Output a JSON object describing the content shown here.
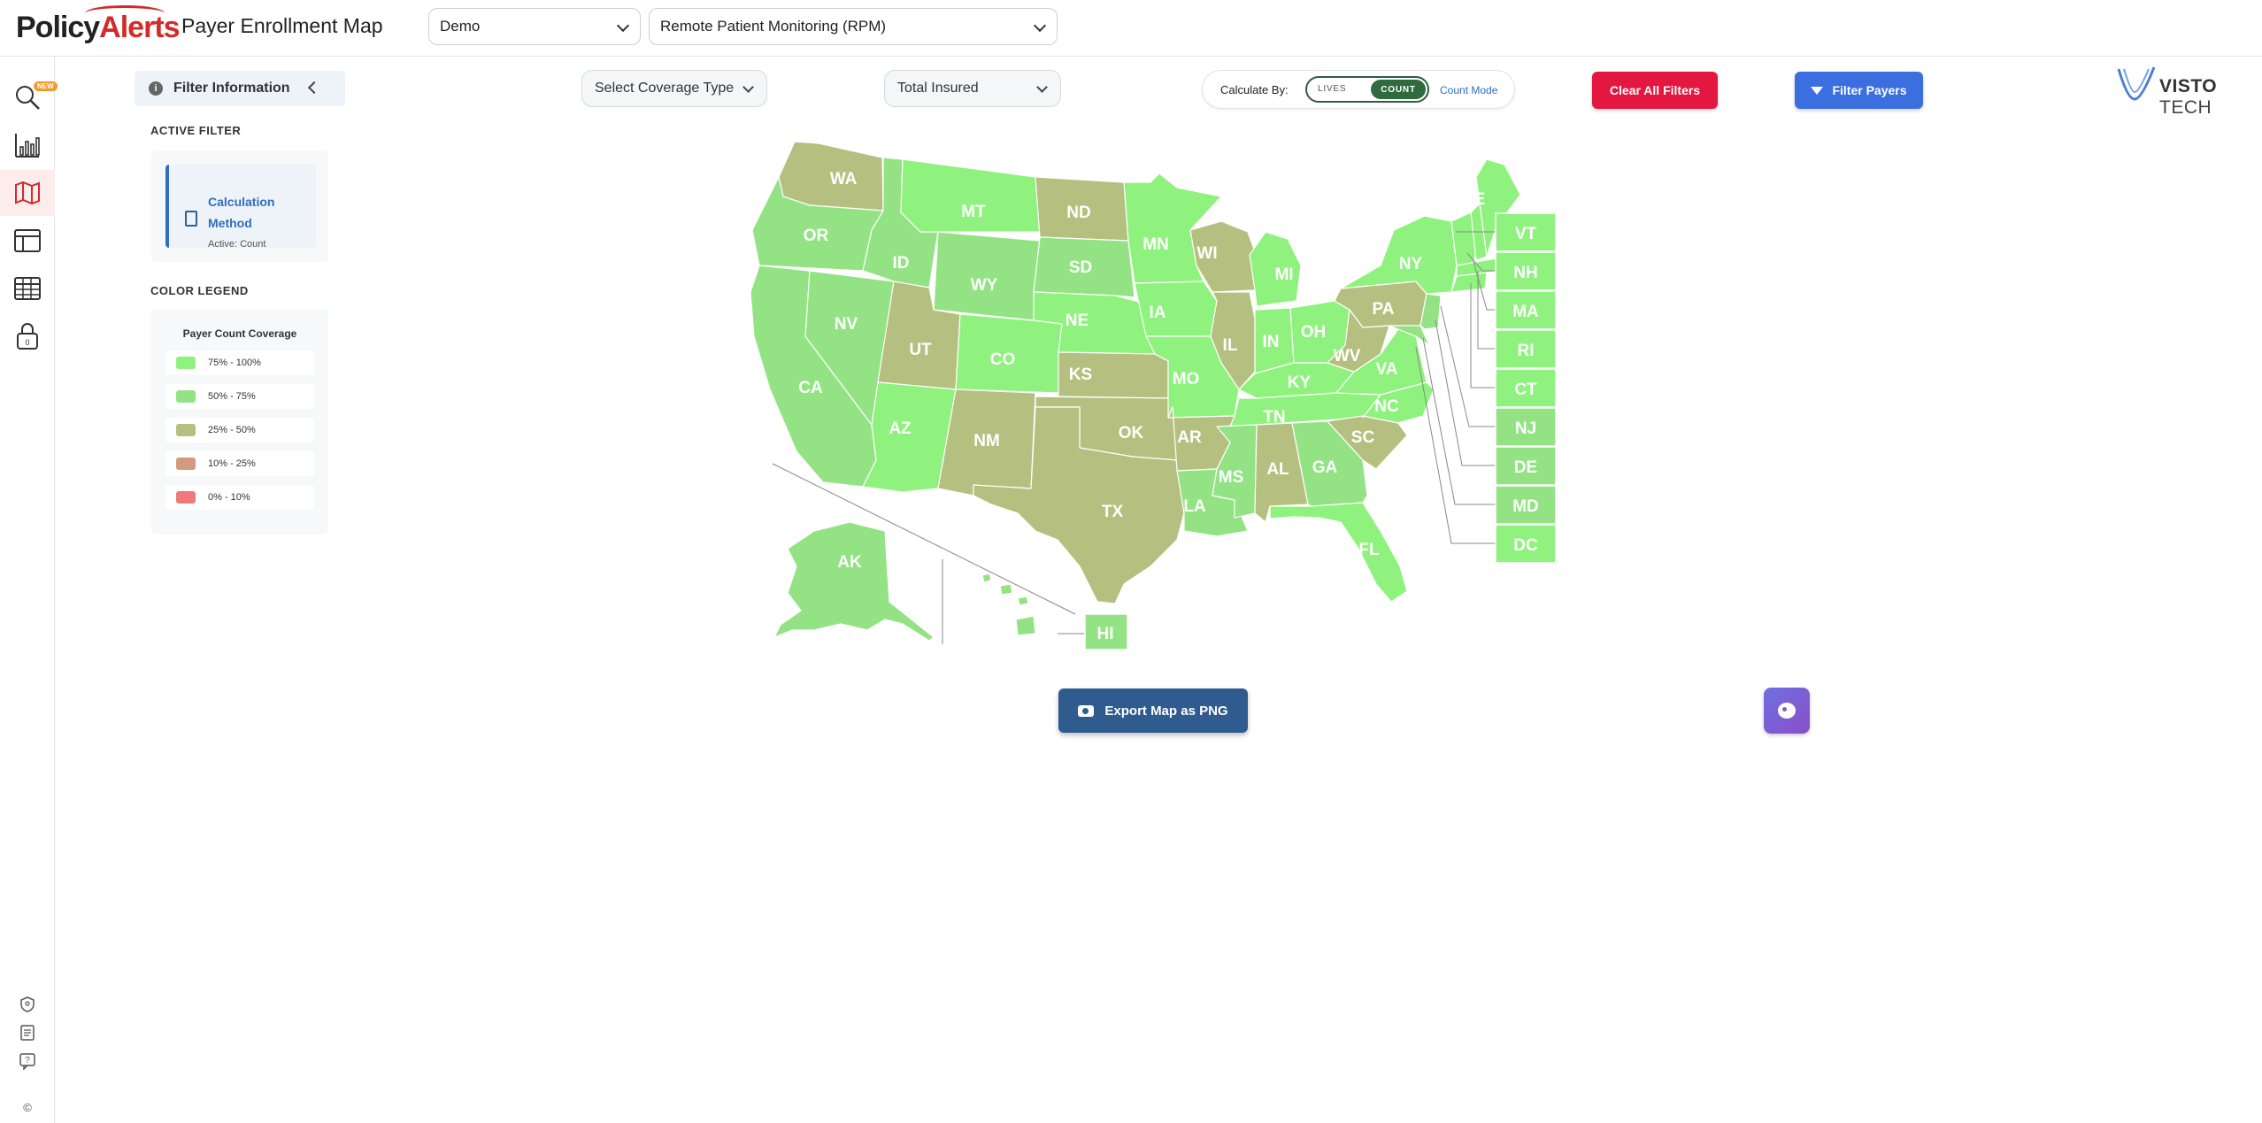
{
  "header": {
    "logo_part1": "Policy",
    "logo_part2": "Alerts",
    "title": "Payer Enrollment Map",
    "org_select": "Demo",
    "service_select": "Remote Patient Monitoring (RPM)"
  },
  "rail": {
    "new_badge": "NEW",
    "items": [
      "search-icon",
      "bar-chart-icon",
      "map-icon",
      "layout-icon",
      "table-icon",
      "lock-icon"
    ],
    "lock_count": "0",
    "bottom_items": [
      "shield-icon",
      "document-icon",
      "help-icon"
    ],
    "copyright": "©"
  },
  "filter_panel": {
    "title": "Filter Information",
    "active_filter_label": "ACTIVE FILTER",
    "active_card_title": "Calculation Method",
    "active_card_sub": "Active: Count",
    "color_legend_label": "COLOR LEGEND",
    "legend_title": "Payer Count Coverage",
    "legend": [
      {
        "label": "75% - 100%",
        "color": "#8ff27e"
      },
      {
        "label": "50% - 75%",
        "color": "#93e384"
      },
      {
        "label": "25% - 50%",
        "color": "#b5c080"
      },
      {
        "label": "10% - 25%",
        "color": "#d49a80"
      },
      {
        "label": "0% - 10%",
        "color": "#ee7a7a"
      }
    ]
  },
  "toolbar": {
    "coverage_select": "Select Coverage Type",
    "insured_select": "Total Insured",
    "calculate_label": "Calculate By:",
    "toggle_lives": "LIVES",
    "toggle_count": "COUNT",
    "mode_label": "Count Mode",
    "clear_button": "Clear All Filters",
    "filter_button": "Filter Payers",
    "brand_a": "VISTO",
    "brand_b": "TECH"
  },
  "map": {
    "colors": {
      "high": "#8ff27e",
      "mid": "#93e384",
      "low": "#b5c080"
    },
    "states": {
      "WA": "low",
      "OR": "mid",
      "CA": "mid",
      "NV": "mid",
      "ID": "mid",
      "MT": "high",
      "WY": "mid",
      "UT": "low",
      "AZ": "high",
      "CO": "high",
      "NM": "low",
      "ND": "low",
      "SD": "mid",
      "NE": "high",
      "KS": "low",
      "OK": "low",
      "TX": "low",
      "MN": "high",
      "IA": "high",
      "MO": "high",
      "AR": "low",
      "LA": "mid",
      "WI": "low",
      "IL": "low",
      "MI": "high",
      "IN": "high",
      "OH": "high",
      "KY": "high",
      "TN": "high",
      "MS": "mid",
      "AL": "low",
      "GA": "mid",
      "FL": "high",
      "SC": "low",
      "NC": "high",
      "VA": "high",
      "WV": "low",
      "PA": "low",
      "NY": "high",
      "ME": "high",
      "AK": "mid",
      "HI": "mid",
      "VT": "high",
      "NH": "high",
      "MA": "high",
      "RI": "high",
      "CT": "high",
      "NJ": "mid",
      "DE": "mid",
      "MD": "mid",
      "DC": "high"
    }
  },
  "export_button": "Export Map as PNG",
  "palette_button": "palette-icon"
}
